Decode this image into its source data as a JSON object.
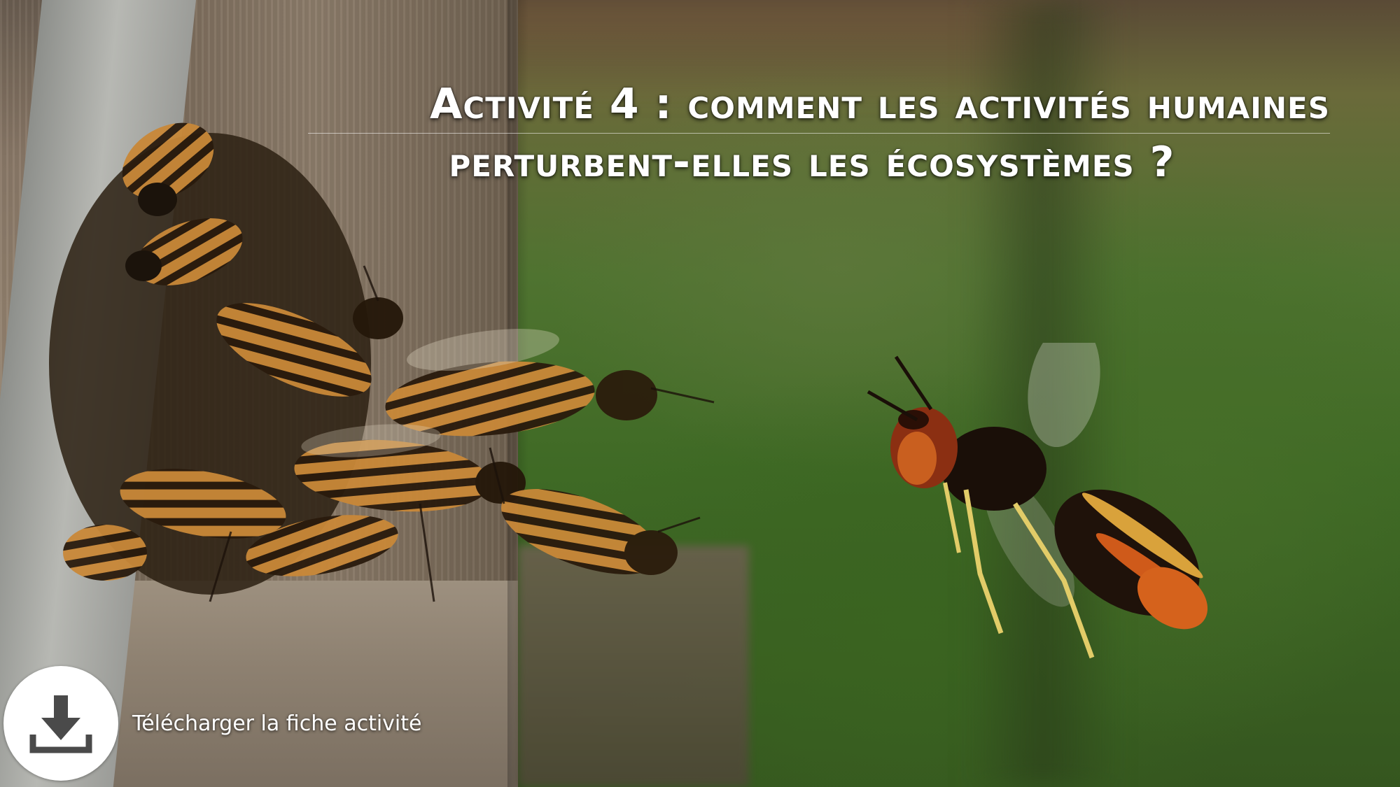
{
  "title": {
    "line1": "Activité 4 : comment les activités humaines",
    "line2": "perturbent-elles les écosystèmes ?"
  },
  "download": {
    "label": "Télécharger la fiche activité",
    "icon": "download-icon"
  },
  "colors": {
    "title_text": "#ffffff",
    "icon_circle": "#ffffff",
    "icon_glyph": "#4a4a4a"
  }
}
